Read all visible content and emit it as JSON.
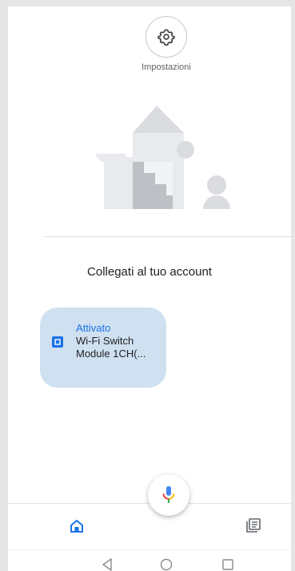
{
  "header": {
    "settings_label": "Impostazioni",
    "settings_icon": "gear-icon"
  },
  "main": {
    "connect_title": "Collegati al tuo account"
  },
  "device": {
    "status": "Attivato",
    "name": "Wi-Fi Switch Module 1CH(...",
    "icon": "switch-icon"
  },
  "bottom_nav": {
    "items": [
      {
        "name": "home",
        "icon": "home-icon"
      },
      {
        "name": "feed",
        "icon": "feed-icon"
      }
    ],
    "assistant_icon": "mic-icon"
  },
  "colors": {
    "accent": "#1a73e8",
    "card_bg": "#cfe0f1",
    "mic_blue": "#4285f4",
    "mic_red": "#ea4335",
    "mic_yellow": "#fbbc04",
    "mic_green": "#34a853"
  }
}
